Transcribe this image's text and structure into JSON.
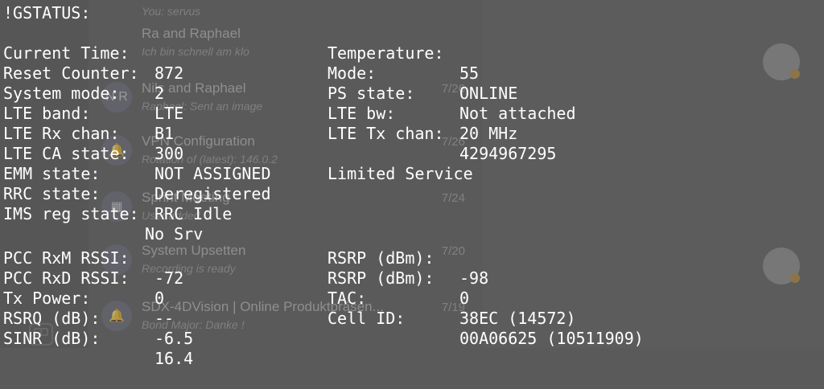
{
  "background_app": {
    "chats": [
      {
        "title": "Nils and Raphael",
        "subtitle": "Raphael: Sent an image",
        "date": "7/26"
      },
      {
        "title": "VPN Configuration",
        "subtitle": "Rotation of (latest): 146.0.2",
        "date": "7/26"
      },
      {
        "title": "Sprint Meeting",
        "subtitle": "User added",
        "date": "7/24"
      },
      {
        "title": "System Upsetten",
        "subtitle": "Recording is ready",
        "date": "7/20"
      },
      {
        "title": "SDX-4DVision | Online Produktpräsen...",
        "subtitle": "Bond Major: Danke !",
        "date": "7/19"
      }
    ],
    "top_snippet": "You: servus",
    "row2_snippet": "Ich bin schnell am klo",
    "row1_title": "Ra   and Raphael"
  },
  "terminal": {
    "header": "!GSTATUS:",
    "left": [
      {
        "label": "Current Time:",
        "value": "872"
      },
      {
        "label": "Reset Counter:",
        "value": "2"
      },
      {
        "label": "System mode:",
        "value": "LTE"
      },
      {
        "label": "LTE band:",
        "value": "B1"
      },
      {
        "label": "LTE Rx chan:",
        "value": "300"
      },
      {
        "label": "LTE CA state:",
        "value": "NOT ASSIGNED"
      },
      {
        "label": "EMM state:",
        "value": "Deregistered"
      },
      {
        "label": "RRC state:",
        "value": "RRC Idle"
      },
      {
        "label": "IMS reg state:",
        "value": "No Srv"
      }
    ],
    "right": [
      {
        "label": "Temperature:",
        "value": "55"
      },
      {
        "label": "Mode:",
        "value": "ONLINE"
      },
      {
        "label": "PS state:",
        "value": "Not attached"
      },
      {
        "label": "LTE bw:",
        "value": "20 MHz"
      },
      {
        "label": "LTE Tx chan:",
        "value": "4294967295"
      },
      {
        "label": "",
        "value": ""
      },
      {
        "label": "Limited Service",
        "value": ""
      }
    ],
    "left2": [
      {
        "label": "PCC RxM RSSI:",
        "value": "-72"
      },
      {
        "label": "PCC RxD RSSI:",
        "value": "0"
      },
      {
        "label": "Tx Power:",
        "value": "--"
      },
      {
        "label": "RSRQ (dB):",
        "value": "-6.5"
      },
      {
        "label": "SINR (dB):",
        "value": "16.4"
      }
    ],
    "right2": [
      {
        "label": "RSRP (dBm):",
        "value": "-98"
      },
      {
        "label": "RSRP (dBm):",
        "value": "0"
      },
      {
        "label": "TAC:",
        "value": "38EC (14572)"
      },
      {
        "label": "Cell ID:",
        "value": "00A06625 (10511909)"
      }
    ]
  }
}
